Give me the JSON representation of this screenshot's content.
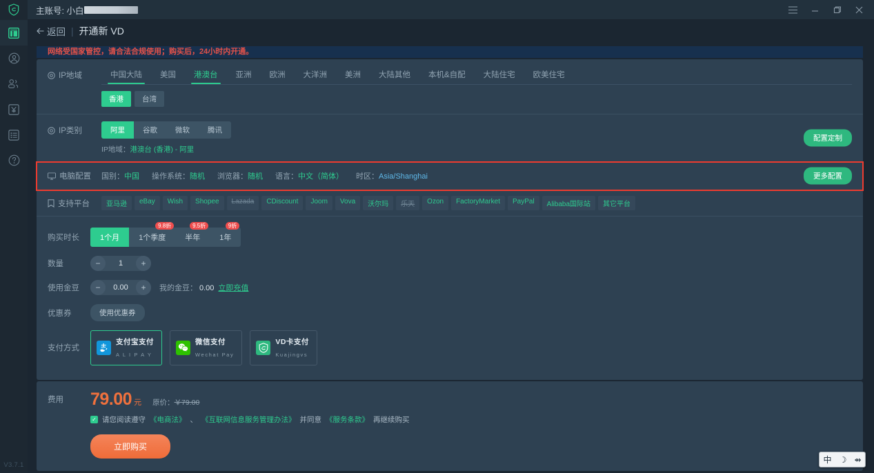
{
  "titlebar": {
    "account_label": "主账号: 小白",
    "menu_icon": "hamburger-icon",
    "minimize": "—",
    "maximize": "❐",
    "close": "✕"
  },
  "sidebar": {
    "version": "V3.7.1",
    "items": [
      {
        "name": "dashboard",
        "icon": "dashboard-icon",
        "active": true
      },
      {
        "name": "account",
        "icon": "user-circle-icon",
        "active": false
      },
      {
        "name": "team",
        "icon": "users-icon",
        "active": false
      },
      {
        "name": "finance",
        "icon": "yuan-icon",
        "active": false
      },
      {
        "name": "orders",
        "icon": "list-icon",
        "active": false
      },
      {
        "name": "help",
        "icon": "question-circle-icon",
        "active": false
      }
    ]
  },
  "breadcrumb": {
    "back": "返回",
    "separator": "|",
    "current": "开通新 VD"
  },
  "banner": {
    "text": "网络受国家管控，请合法合规使用；购买后，24小时内开通。"
  },
  "ip_region": {
    "label": "IP地域",
    "icon": "location-icon",
    "tabs": [
      "中国大陆",
      "美国",
      "港澳台",
      "亚洲",
      "欧洲",
      "大洋洲",
      "美洲",
      "大陆其他",
      "本机&自配",
      "大陆住宅",
      "欧美住宅"
    ],
    "active_tab": "港澳台",
    "sub_pills": [
      "香港",
      "台湾"
    ],
    "active_pill": "香港"
  },
  "ip_type": {
    "label": "IP类别",
    "icon": "location-icon",
    "options": [
      "阿里",
      "谷歌",
      "微软",
      "腾讯"
    ],
    "active": "阿里",
    "summary_prefix": "IP地域：",
    "summary_value": "港澳台 (香港) - 阿里",
    "action_label": "配置定制"
  },
  "pc_config": {
    "label": "电脑配置",
    "icon": "monitor-icon",
    "fields": [
      {
        "k": "国别：",
        "v": "中国",
        "style": "green"
      },
      {
        "k": "操作系统：",
        "v": "随机",
        "style": "green"
      },
      {
        "k": "浏览器：",
        "v": "随机",
        "style": "green"
      },
      {
        "k": "语言：",
        "v": "中文（简体）",
        "style": "green"
      },
      {
        "k": "时区：",
        "v": "Asia/Shanghai",
        "style": "blue"
      }
    ],
    "action_label": "更多配置",
    "highlighted": true,
    "highlight_color": "#ef3b2f"
  },
  "platforms": {
    "label": "支持平台",
    "icon": "bookmark-icon",
    "items": [
      {
        "name": "亚马逊",
        "strike": false
      },
      {
        "name": "eBay",
        "strike": false
      },
      {
        "name": "Wish",
        "strike": false
      },
      {
        "name": "Shopee",
        "strike": false
      },
      {
        "name": "Lazada",
        "strike": true
      },
      {
        "name": "CDiscount",
        "strike": false
      },
      {
        "name": "Joom",
        "strike": false
      },
      {
        "name": "Vova",
        "strike": false
      },
      {
        "name": "沃尔玛",
        "strike": false
      },
      {
        "name": "乐天",
        "strike": true
      },
      {
        "name": "Ozon",
        "strike": false
      },
      {
        "name": "FactoryMarket",
        "strike": false
      },
      {
        "name": "PayPal",
        "strike": false
      },
      {
        "name": "Alibaba国际站",
        "strike": false
      },
      {
        "name": "其它平台",
        "strike": false
      }
    ]
  },
  "order": {
    "duration": {
      "label": "购买时长",
      "options": [
        {
          "text": "1个月",
          "badge": "",
          "active": true
        },
        {
          "text": "1个季度",
          "badge": "9.8折",
          "active": false
        },
        {
          "text": "半年",
          "badge": "9.5折",
          "active": false
        },
        {
          "text": "1年",
          "badge": "9折",
          "active": false
        }
      ]
    },
    "quantity": {
      "label": "数量",
      "minus": "−",
      "value": "1",
      "plus": "+"
    },
    "coin": {
      "label": "使用金豆",
      "minus": "−",
      "value": "0.00",
      "plus": "+",
      "note_label": "我的金豆：",
      "note_value": "0.00",
      "recharge_link": "立即充值"
    },
    "coupon": {
      "label": "优惠券",
      "button": "使用优惠券"
    },
    "payment": {
      "label": "支付方式",
      "methods": [
        {
          "title": "支付宝支付",
          "sub": "A L I P A Y",
          "icon": "alipay-icon",
          "color": "#1296db",
          "selected": true
        },
        {
          "title": "微信支付",
          "sub": "Wechat Pay",
          "icon": "wechat-icon",
          "color": "#2dc100",
          "selected": false
        },
        {
          "title": "VD卡支付",
          "sub": "Kuajingvs",
          "icon": "vdcard-icon",
          "color": "#2eb87f",
          "selected": false
        }
      ]
    }
  },
  "fee": {
    "label": "费用",
    "amount": "79.00",
    "unit": "元",
    "original_prefix": "原价：",
    "original_value": "￥79.00",
    "agreement": {
      "checked": true,
      "check_glyph": "✓",
      "pre": "请您阅读遵守",
      "link1": "《电商法》",
      "mid1": "、",
      "link2": "《互联网信息服务管理办法》",
      "mid2": "并同意",
      "link3": "《服务条款》",
      "post": "再继续购买"
    },
    "buy_button": "立即购买"
  },
  "ime": {
    "lang": "中",
    "mode": "☽",
    "tool": "⇴"
  },
  "colors": {
    "accent_green": "#2ecc8f",
    "price_orange": "#f0713d",
    "alert_red": "#e4524a",
    "card_bg": "#2e4152",
    "page_bg": "#1b2631",
    "highlight": "#ef3b2f"
  }
}
